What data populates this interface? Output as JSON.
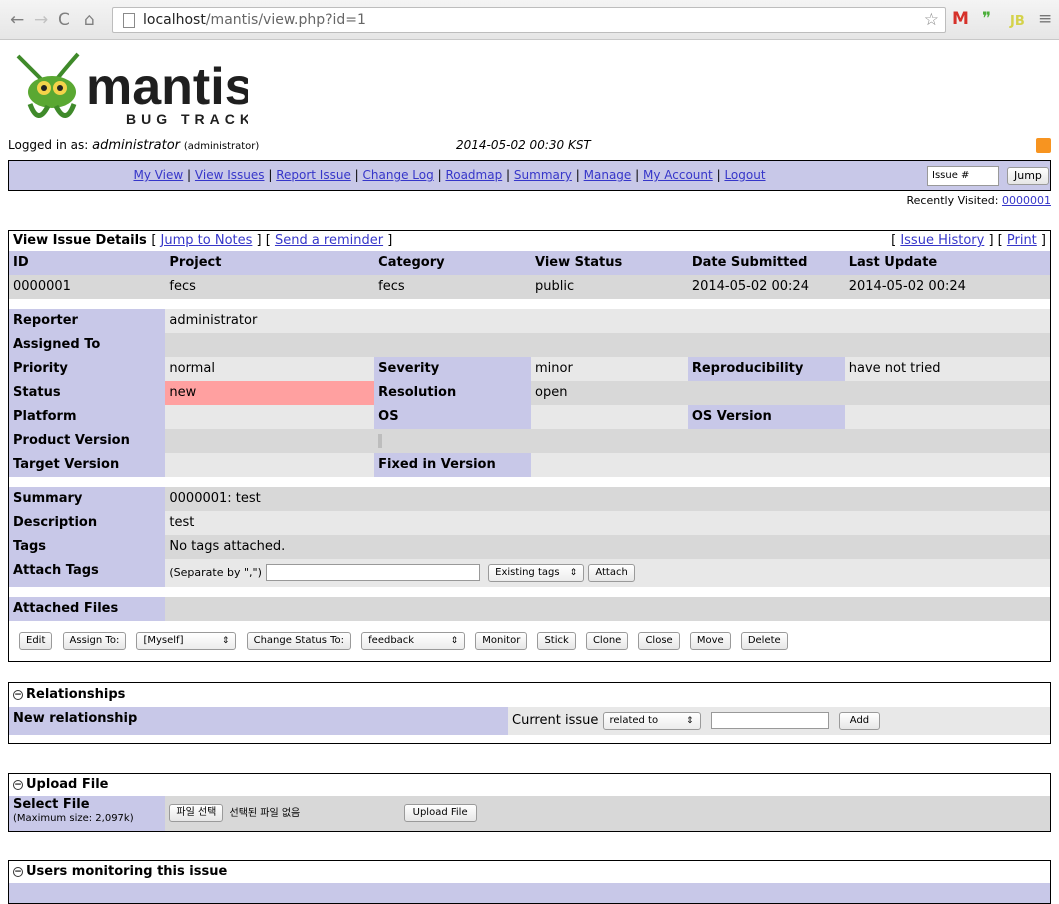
{
  "browser": {
    "url_host": "localhost",
    "url_path": "/mantis/view.php?id=1"
  },
  "header": {
    "logo_word": "mantis",
    "logo_sub": "BUG TRACKER",
    "logged_in_prefix": "Logged in as:",
    "user": "administrator",
    "role": "(administrator)",
    "datetime": "2014-05-02 00:30 KST",
    "recently_visited_label": "Recently Visited:",
    "recently_visited_link": "0000001"
  },
  "menu": {
    "items": [
      "My View",
      "View Issues",
      "Report Issue",
      "Change Log",
      "Roadmap",
      "Summary",
      "Manage",
      "My Account",
      "Logout"
    ],
    "bug_id_placeholder": "Issue #",
    "jump": "Jump"
  },
  "details": {
    "title": "View Issue Details",
    "jump_notes": "Jump to Notes",
    "send_reminder": "Send a reminder",
    "issue_history": "Issue History",
    "print": "Print",
    "headers": [
      "ID",
      "Project",
      "Category",
      "View Status",
      "Date Submitted",
      "Last Update"
    ],
    "values": [
      "0000001",
      "fecs",
      "fecs",
      "public",
      "2014-05-02 00:24",
      "2014-05-02 00:24"
    ],
    "reporter_label": "Reporter",
    "reporter": "administrator",
    "assigned_label": "Assigned To",
    "assigned": "",
    "priority_label": "Priority",
    "priority": "normal",
    "severity_label": "Severity",
    "severity": "minor",
    "repro_label": "Reproducibility",
    "repro": "have not tried",
    "status_label": "Status",
    "status": "new",
    "resolution_label": "Resolution",
    "resolution": "open",
    "platform_label": "Platform",
    "os_label": "OS",
    "os_version_label": "OS Version",
    "product_version_label": "Product Version",
    "target_version_label": "Target Version",
    "fixed_version_label": "Fixed in Version",
    "summary_label": "Summary",
    "summary": "0000001: test",
    "description_label": "Description",
    "description": "test",
    "tags_label": "Tags",
    "tags": "No tags attached.",
    "attach_tags_label": "Attach Tags",
    "separate_hint": "(Separate by \",\")",
    "existing_tags": "Existing tags",
    "attach": "Attach",
    "attached_files_label": "Attached Files"
  },
  "actions": {
    "edit": "Edit",
    "assign_to": "Assign To:",
    "assign_value": "[Myself]",
    "change_status": "Change Status To:",
    "status_value": "feedback",
    "monitor": "Monitor",
    "stick": "Stick",
    "clone": "Clone",
    "close": "Close",
    "move": "Move",
    "delete": "Delete"
  },
  "relationships": {
    "title": "Relationships",
    "new_label": "New relationship",
    "current_issue": "Current issue",
    "relation_value": "related to",
    "add": "Add"
  },
  "upload": {
    "title": "Upload File",
    "select_label": "Select File",
    "max_size": "(Maximum size: 2,097k)",
    "choose_file": "파일 선택",
    "no_file": "선택된 파일 없음",
    "upload_button": "Upload File"
  },
  "monitoring": {
    "title": "Users monitoring this issue"
  }
}
